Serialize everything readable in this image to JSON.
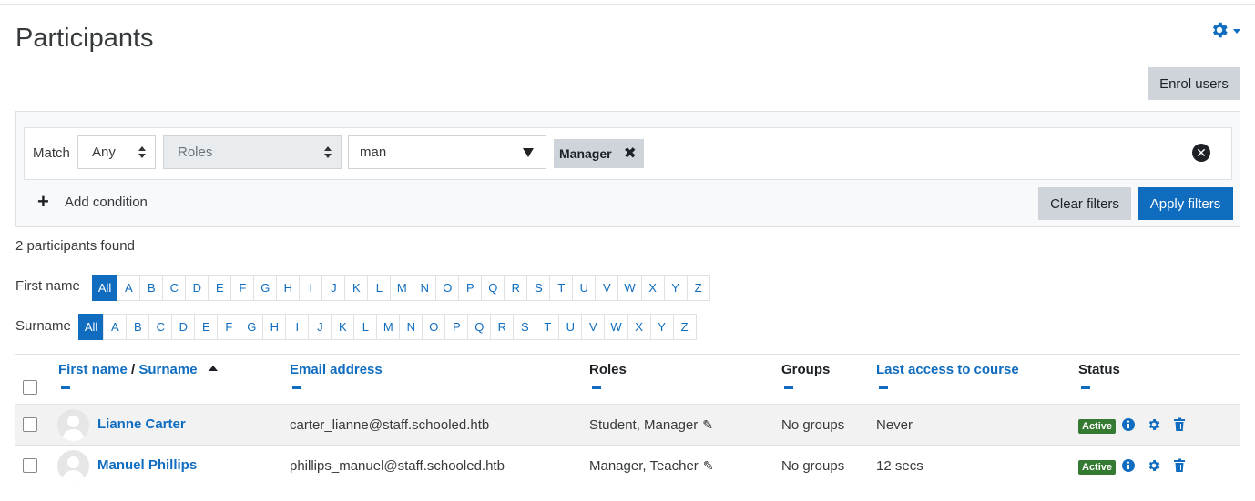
{
  "page": {
    "title": "Participants",
    "enrol_label": "Enrol users",
    "found_text": "2 participants found"
  },
  "filter": {
    "match_label": "Match",
    "match_value": "Any",
    "type_value": "Roles",
    "value_text": "man",
    "chip_label": "Manager",
    "add_condition_label": "Add condition",
    "clear_label": "Clear filters",
    "apply_label": "Apply filters"
  },
  "initials": {
    "first_label": "First name",
    "surname_label": "Surname",
    "letters": [
      "All",
      "A",
      "B",
      "C",
      "D",
      "E",
      "F",
      "G",
      "H",
      "I",
      "J",
      "K",
      "L",
      "M",
      "N",
      "O",
      "P",
      "Q",
      "R",
      "S",
      "T",
      "U",
      "V",
      "W",
      "X",
      "Y",
      "Z"
    ],
    "active": "All"
  },
  "table": {
    "headers": {
      "first_name": "First name",
      "separator": "/",
      "surname": "Surname",
      "email": "Email address",
      "roles": "Roles",
      "groups": "Groups",
      "last_access": "Last access to course",
      "status": "Status"
    },
    "rows": [
      {
        "name": "Lianne Carter",
        "email": "carter_lianne@staff.schooled.htb",
        "roles": "Student, Manager",
        "groups": "No groups",
        "last_access": "Never",
        "status": "Active"
      },
      {
        "name": "Manuel Phillips",
        "email": "phillips_manuel@staff.schooled.htb",
        "roles": "Manager, Teacher",
        "groups": "No groups",
        "last_access": "12 secs",
        "status": "Active"
      }
    ]
  },
  "colors": {
    "primary": "#0f6cbf",
    "secondary": "#ced4da",
    "active_badge": "#357a32"
  },
  "icons": {
    "settings": "gear-icon",
    "remove": "close-icon",
    "add": "plus-icon",
    "edit": "pencil-icon",
    "info": "info-icon",
    "trash": "trash-icon"
  }
}
